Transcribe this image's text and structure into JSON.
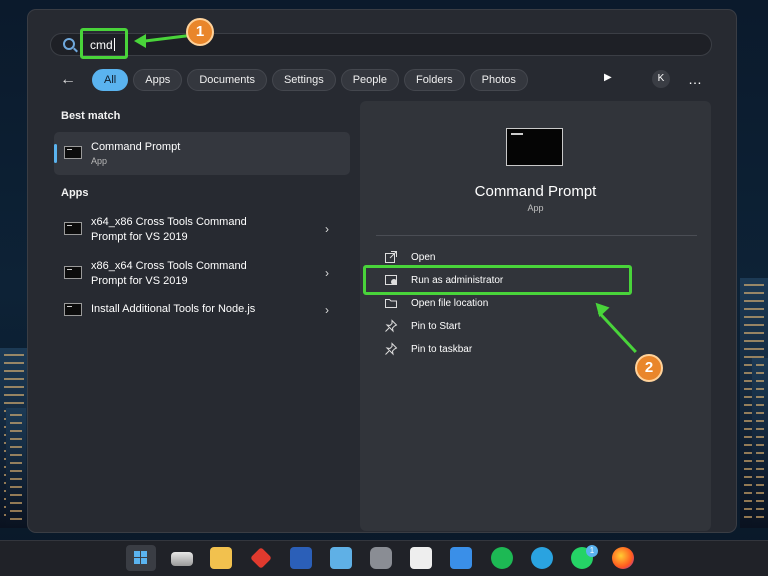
{
  "search": {
    "query": "cmd"
  },
  "filters": [
    "All",
    "Apps",
    "Documents",
    "Settings",
    "People",
    "Folders",
    "Photos"
  ],
  "user_initial": "K",
  "more_label": "…",
  "best_match": {
    "heading": "Best match",
    "title": "Command Prompt",
    "subtitle": "App"
  },
  "apps": {
    "heading": "Apps",
    "items": [
      {
        "line1": "x64_x86 Cross Tools Command",
        "line2": "Prompt for VS 2019"
      },
      {
        "line1": "x86_x64 Cross Tools Command",
        "line2": "Prompt for VS 2019"
      },
      {
        "line1": "Install Additional Tools for Node.js",
        "line2": ""
      }
    ]
  },
  "detail": {
    "title": "Command Prompt",
    "subtitle": "App",
    "actions": [
      {
        "label": "Open",
        "icon": "open-icon"
      },
      {
        "label": "Run as administrator",
        "icon": "shield-icon"
      },
      {
        "label": "Open file location",
        "icon": "folder-icon"
      },
      {
        "label": "Pin to Start",
        "icon": "pin-icon"
      },
      {
        "label": "Pin to taskbar",
        "icon": "pin-icon"
      }
    ]
  },
  "annotations": {
    "step1": "1",
    "step2": "2",
    "highlight_color": "#49d43a",
    "badge_color": "#e9862b"
  },
  "taskbar": {
    "whatsapp_badge": "1"
  }
}
